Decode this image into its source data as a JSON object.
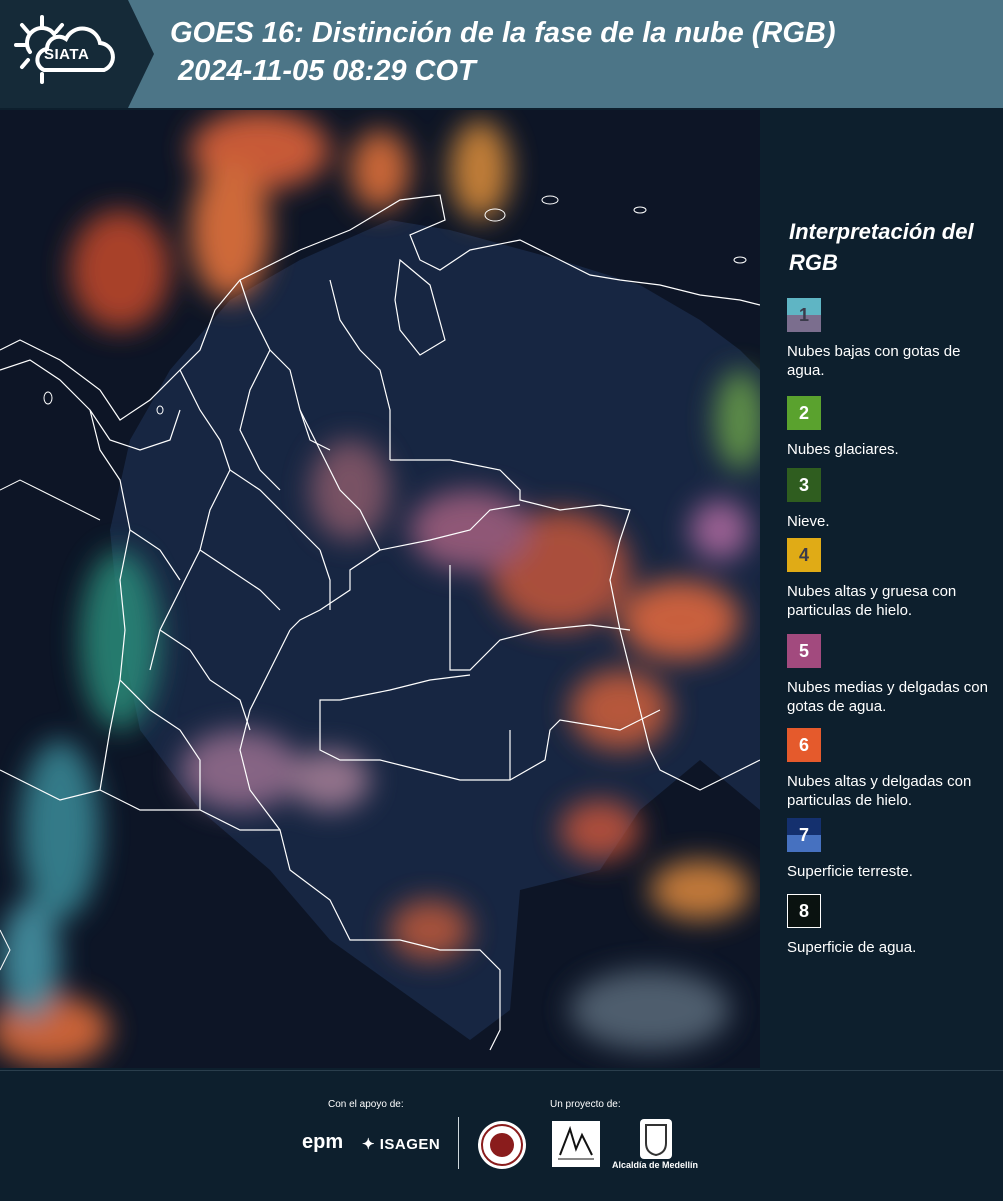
{
  "header": {
    "logo_text": "SIATA",
    "title": "GOES 16: Distinción de la fase de la nube (RGB)\n 2024-11-05 08:29 COT"
  },
  "map": {
    "image": "satellite-rgb-image",
    "region": "Colombia"
  },
  "legend": {
    "title": "Interpretación del RGB",
    "items": [
      {
        "number": "1",
        "label": "Nubes bajas con gotas de agua.",
        "color_top": "#5fb5c4",
        "color_bottom": "#7b6e8e",
        "text_color": "#3a3a4a"
      },
      {
        "number": "2",
        "label": "Nubes glaciares.",
        "color_top": "#5aa22e",
        "color_bottom": "#5aa22e",
        "text_color": "#ffffff"
      },
      {
        "number": "3",
        "label": "Nieve.",
        "color_top": "#2f5d1f",
        "color_bottom": "#2f5d1f",
        "text_color": "#ffffff"
      },
      {
        "number": "4",
        "label": "Nubes altas y gruesa con particulas de hielo.",
        "color_top": "#e0ab16",
        "color_bottom": "#e0ab16",
        "text_color": "#3a3a4a"
      },
      {
        "number": "5",
        "label": "Nubes medias y delgadas con gotas de agua.",
        "color_top": "#a24a7e",
        "color_bottom": "#a24a7e",
        "text_color": "#ffffff"
      },
      {
        "number": "6",
        "label": "Nubes altas y delgadas con particulas de hielo.",
        "color_top": "#e55a2c",
        "color_bottom": "#e55a2c",
        "text_color": "#ffffff"
      },
      {
        "number": "7",
        "label": "Superficie terreste.",
        "color_top": "#14306e",
        "color_bottom": "#4671c0",
        "text_color": "#ffffff"
      },
      {
        "number": "8",
        "label": "Superficie de agua.",
        "color_top": "#0a1210",
        "color_bottom": "#0a1210",
        "text_color": "#ffffff"
      }
    ]
  },
  "footer": {
    "support_label": "Con el apoyo de:",
    "project_label": "Un proyecto de:",
    "epm_text": "epm",
    "isagen_text": "ISAGEN",
    "alcaldia_text": "Alcaldía de Medellín"
  }
}
